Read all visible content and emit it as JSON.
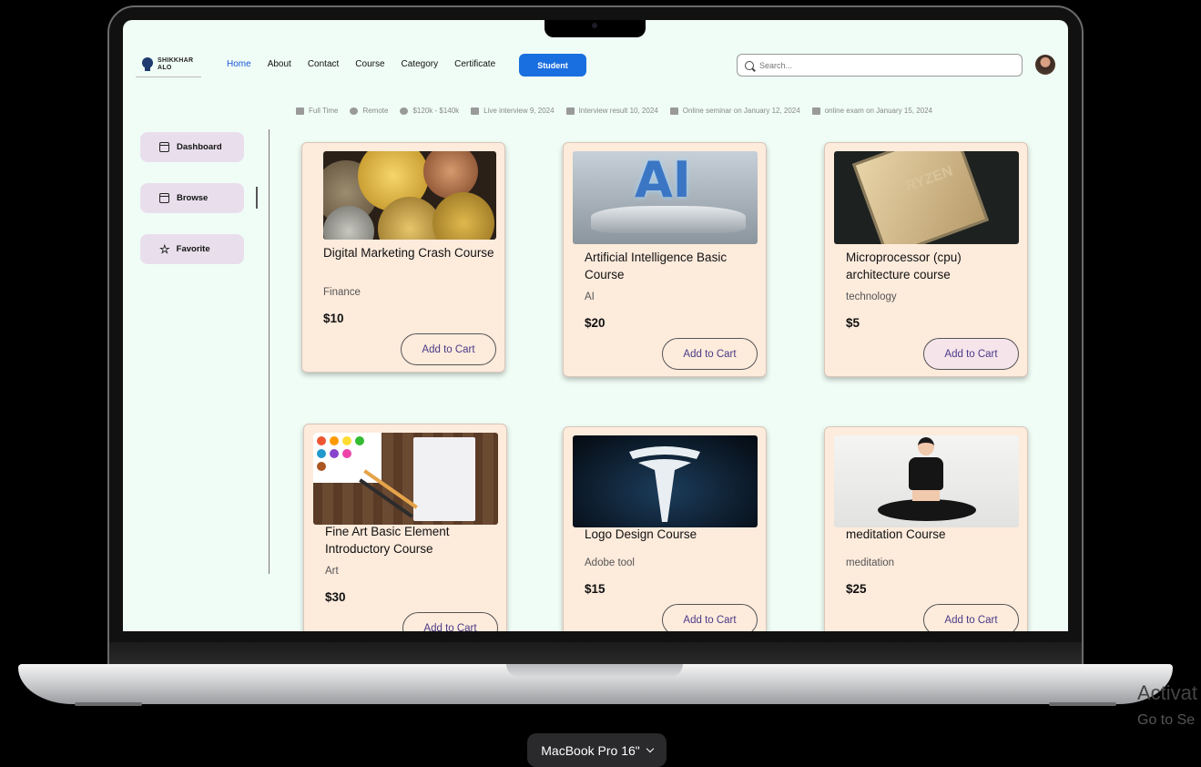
{
  "logo": {
    "line1": "SHIKKHAR",
    "line2": "ALO"
  },
  "nav": {
    "items": [
      "Home",
      "About",
      "Contact",
      "Course",
      "Category",
      "Certificate"
    ],
    "active": "Home",
    "student_label": "Student"
  },
  "search": {
    "placeholder": "Search..."
  },
  "meta": [
    {
      "icon": "briefcase-icon",
      "text": "Full Time"
    },
    {
      "icon": "location-icon",
      "text": "Remote"
    },
    {
      "icon": "dollar-icon",
      "text": "$120k - $140k"
    },
    {
      "icon": "calendar-icon",
      "text": "Live interview 9, 2024"
    },
    {
      "icon": "calendar-icon",
      "text": "Interview result 10, 2024"
    },
    {
      "icon": "calendar-icon",
      "text": "Online seminar on January 12, 2024"
    },
    {
      "icon": "calendar-icon",
      "text": "online exam on January 15, 2024"
    }
  ],
  "sidebar": {
    "items": [
      {
        "label": "Dashboard",
        "icon": "calendar-icon"
      },
      {
        "label": "Browse",
        "icon": "calendar-icon"
      },
      {
        "label": "Favorite",
        "icon": "star-icon"
      }
    ]
  },
  "cards": [
    {
      "title": "Digital Marketing Crash Course",
      "category": "Finance",
      "price": "$10",
      "button": "Add to Cart",
      "image": "crypto-coins"
    },
    {
      "title": "Artificial Intelligence Basic Course",
      "category": "AI",
      "price": "$20",
      "button": "Add to Cart",
      "image": "ai-robot-hand"
    },
    {
      "title": "Microprocessor (cpu) architecture course",
      "category": "technology",
      "price": "$5",
      "button": "Add to Cart",
      "image": "ryzen-cpu"
    },
    {
      "title": "Fine Art Basic Element Introductory Course",
      "category": "Art",
      "price": "$30",
      "button": "Add to Cart",
      "image": "paint-palette-notebook"
    },
    {
      "title": "Logo Design Course",
      "category": "Adobe tool",
      "price": "$15",
      "button": "Add to Cart",
      "image": "tesla-logo"
    },
    {
      "title": "meditation Course",
      "category": "meditation",
      "price": "$25",
      "button": "Add to Cart",
      "image": "woman-meditating"
    }
  ],
  "cpu_text": "RYZEN",
  "ai_text": "AI",
  "overlay": {
    "activate": "Activat",
    "goto": "Go to Se"
  },
  "device": {
    "label": "MacBook Pro 16\""
  },
  "colors": {
    "accent": "#1a6fe0",
    "card_bg": "#fdebdc",
    "screen_bg": "#f0fdf6",
    "sidebar_btn": "#e9dfec"
  }
}
